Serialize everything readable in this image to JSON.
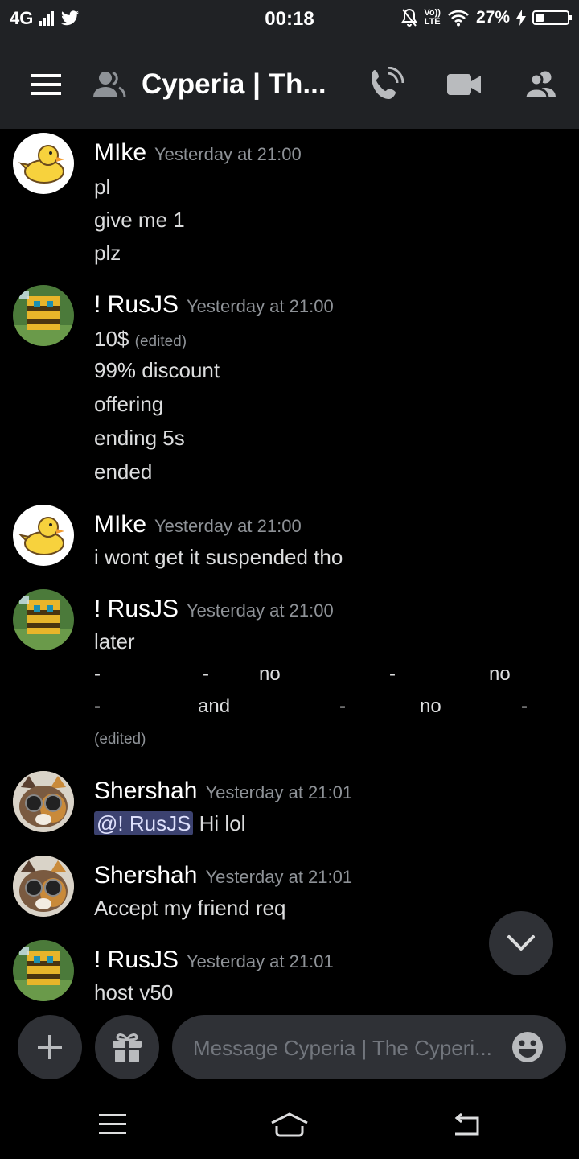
{
  "status_bar": {
    "network": "4G",
    "time": "00:18",
    "volte_top": "Vo))",
    "volte_bottom": "LTE",
    "battery_percent": "27%",
    "battery_level": 0.27
  },
  "header": {
    "channel_title": "Cyperia | Th..."
  },
  "messages": [
    {
      "author": "MIke",
      "timestamp": "Yesterday at 21:00",
      "lines": [
        "pl",
        "give me 1",
        "plz"
      ]
    },
    {
      "author": "! RusJS",
      "timestamp": "Yesterday at 21:00",
      "first_line": "10$",
      "edited_label": "(edited)",
      "lines": [
        "99% discount",
        "offering",
        "ending 5s",
        "ended"
      ]
    },
    {
      "author": "MIke",
      "timestamp": "Yesterday at 21:00",
      "lines": [
        "i wont get it suspended tho"
      ]
    },
    {
      "author": "! RusJS",
      "timestamp": "Yesterday at 21:00",
      "lines": [
        "later"
      ],
      "table_rows": [
        [
          "-",
          "-",
          "no",
          "-",
          "no"
        ],
        [
          "-",
          "and",
          "-",
          "no",
          "-"
        ]
      ],
      "edited_label": "(edited)"
    },
    {
      "author": "Shershah",
      "timestamp": "Yesterday at 21:01",
      "mention": "@! RusJS",
      "text": "Hi lol"
    },
    {
      "author": "Shershah",
      "timestamp": "Yesterday at 21:01",
      "lines": [
        "Accept my friend req"
      ]
    },
    {
      "author": "! RusJS",
      "timestamp": "Yesterday at 21:01",
      "lines": [
        "host v50"
      ]
    }
  ],
  "composer": {
    "placeholder": "Message Cyperia | The Cyperi..."
  },
  "icons": {
    "menu": "hamburger-menu-icon",
    "channel_members": "members-icon",
    "voice_call": "phone-call-icon",
    "video_call": "video-camera-icon",
    "member_list": "member-list-icon",
    "scroll_down": "chevron-down-icon",
    "add": "plus-icon",
    "gift": "gift-icon",
    "emoji": "emoji-icon"
  },
  "colors": {
    "background": "#000000",
    "header": "#202225",
    "surface": "#2f3136",
    "mention_bg": "#3c4270"
  }
}
